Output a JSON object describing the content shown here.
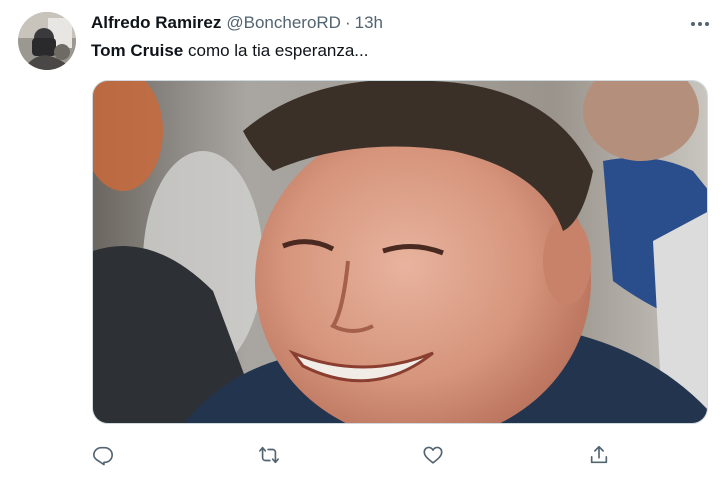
{
  "tweet": {
    "author": {
      "display_name": "Alfredo Ramirez",
      "handle": "@BoncheroRD",
      "separator": "·",
      "time": "13h",
      "avatar_icon": "profile-avatar"
    },
    "text": {
      "mention": "Tom Cruise",
      "body": " como la tia esperanza..."
    },
    "media": {
      "type": "photo"
    },
    "actions": [
      {
        "name": "reply",
        "icon": "reply-icon"
      },
      {
        "name": "retweet",
        "icon": "retweet-icon"
      },
      {
        "name": "like",
        "icon": "heart-icon"
      },
      {
        "name": "share",
        "icon": "share-icon"
      }
    ],
    "colors": {
      "text": "#0f1419",
      "secondary": "#536471",
      "border": "#cfd9de"
    }
  }
}
